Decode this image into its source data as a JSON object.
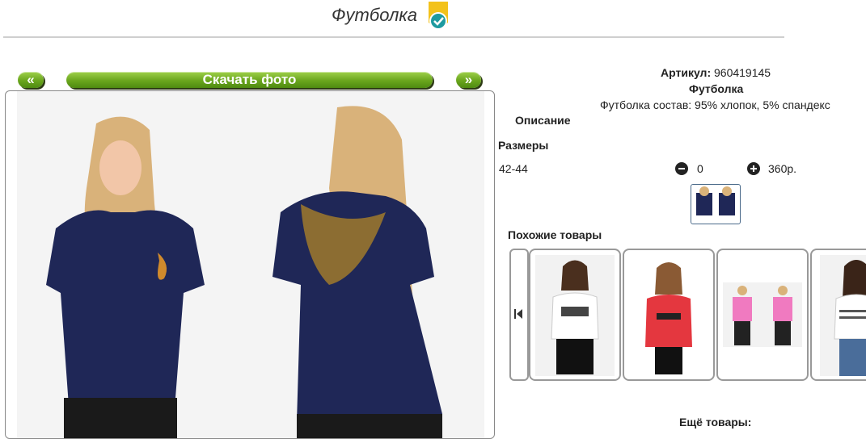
{
  "header": {
    "title": "Футболка"
  },
  "nav": {
    "prev_label": "«",
    "download_label": "Скачать фото",
    "next_label": "»"
  },
  "product": {
    "sku_label": "Артикул:",
    "sku_value": "960419145",
    "name": "Футболка",
    "composition": "Футболка состав: 95% хлопок, 5% спандекс",
    "description_heading": "Описание",
    "sizes_heading": "Размеры",
    "sizes": [
      {
        "size": "42-44",
        "quantity": "0",
        "price": "360р."
      }
    ]
  },
  "similar": {
    "heading": "Похожие товары",
    "more_heading": "Ещё товары:"
  },
  "colors": {
    "accent_green": "#6aa51d",
    "shirt_navy": "#1f2757",
    "badge_yellow": "#f3c21b",
    "badge_teal": "#1e9aa0"
  },
  "icons": [
    "verified-badge-icon",
    "minus-icon",
    "plus-icon",
    "carousel-prev-icon"
  ]
}
